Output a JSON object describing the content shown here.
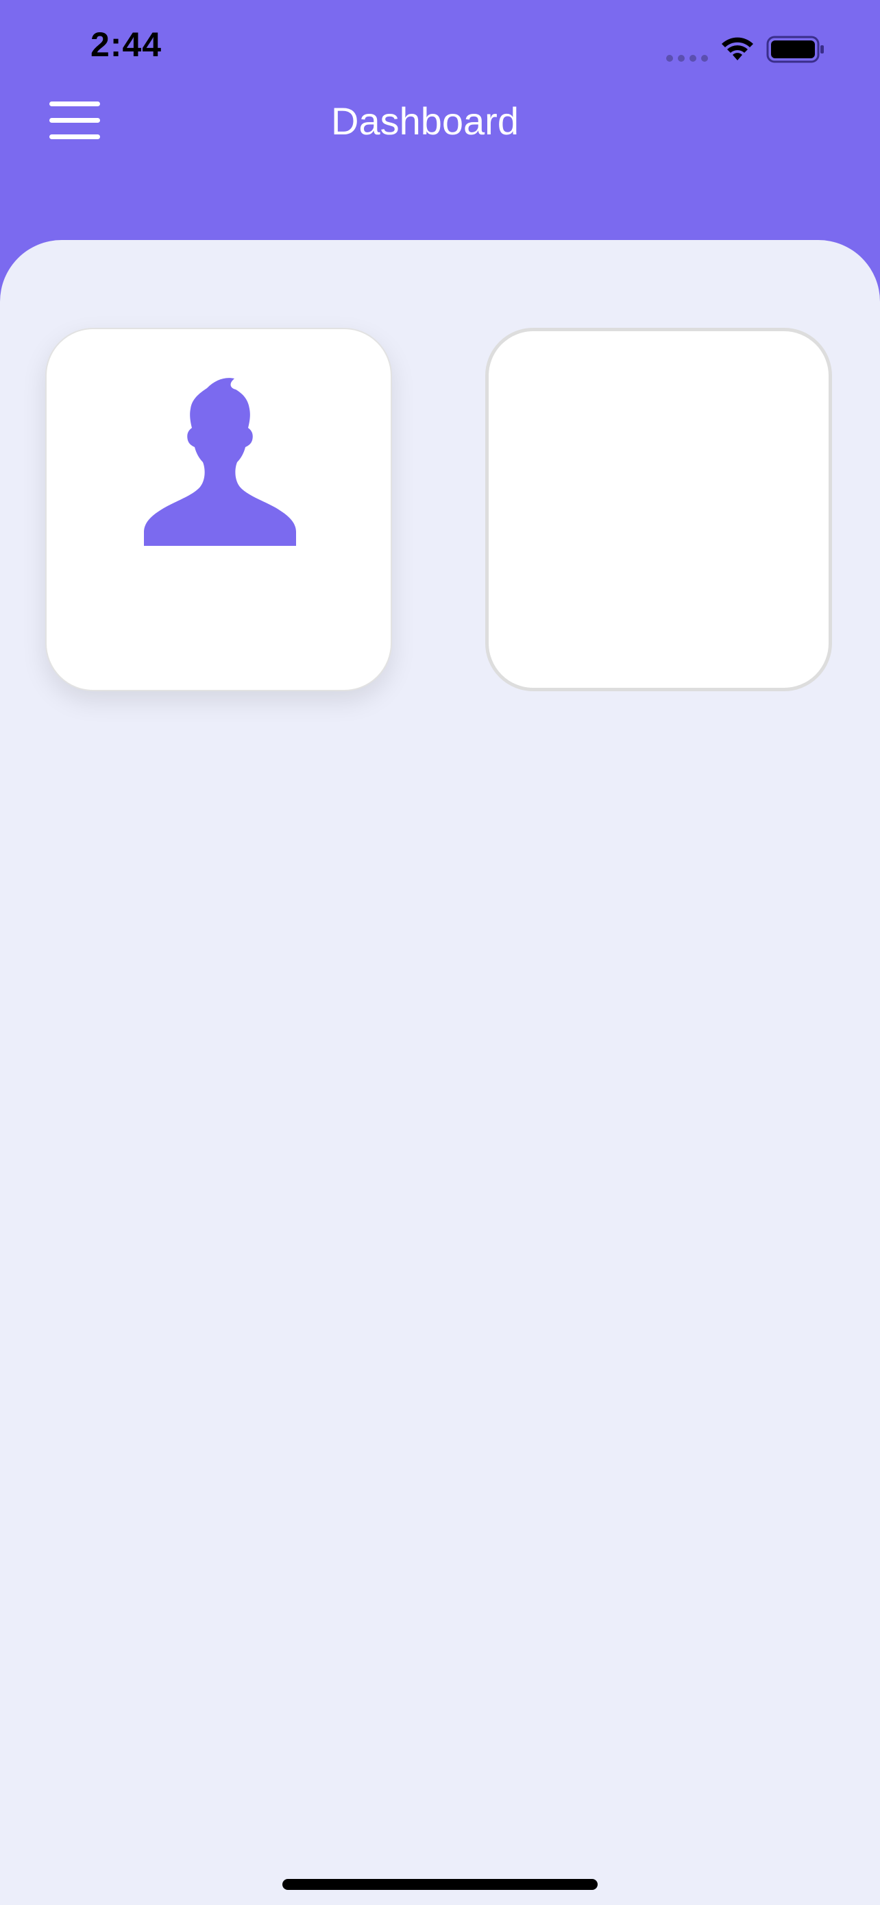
{
  "status_bar": {
    "time": "2:44",
    "icons": [
      "signal-dots-icon",
      "wifi-icon",
      "battery-icon"
    ]
  },
  "header": {
    "title": "Dashboard",
    "menu_icon": "hamburger-menu-icon"
  },
  "cards": [
    {
      "icon": "user-profile-icon"
    },
    {
      "icon": ""
    }
  ],
  "colors": {
    "primary": "#7B6AEF",
    "background": "#ECEEFA",
    "card": "#FFFFFF"
  }
}
